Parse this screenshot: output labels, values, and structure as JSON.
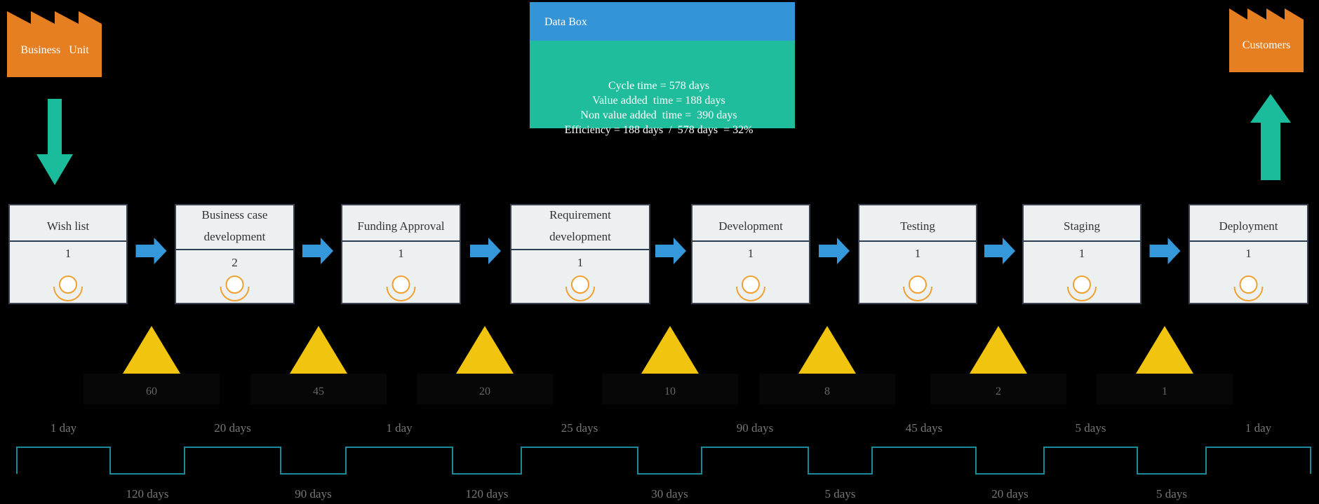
{
  "supplier": {
    "label": "Business   Unit",
    "icon": "factory-icon",
    "color": "#e67e22"
  },
  "customer": {
    "label": "Customers",
    "icon": "factory-icon",
    "color": "#e67e22"
  },
  "data_box": {
    "title": "Data Box",
    "lines": [
      "Cycle time = 578 days",
      "Value added  time = 188 days",
      "Non value added  time =  390 days",
      "Efficiency = 188 days  /  578 days  = 32%"
    ],
    "header_color": "#3498db",
    "body_color": "#1abc9c"
  },
  "processes": [
    {
      "name": [
        "Wish  list"
      ],
      "operators": "1"
    },
    {
      "name": [
        "Business    case",
        "development"
      ],
      "operators": "2"
    },
    {
      "name": [
        "Funding  Approval"
      ],
      "operators": "1"
    },
    {
      "name": [
        "Requirement",
        "development"
      ],
      "operators": "1"
    },
    {
      "name": [
        "Development"
      ],
      "operators": "1"
    },
    {
      "name": [
        "Testing"
      ],
      "operators": "1"
    },
    {
      "name": [
        "Staging"
      ],
      "operators": "1"
    },
    {
      "name": [
        "Deployment"
      ],
      "operators": "1"
    }
  ],
  "inventory": [
    "60",
    "45",
    "20",
    "10",
    "8",
    "2",
    "1"
  ],
  "timeline": {
    "value_added": [
      "1 day",
      "20 days",
      "1 day",
      "25 days",
      "90 days",
      "45 days",
      "5 days",
      "1 day"
    ],
    "waiting": [
      "120 days",
      "90 days",
      "120 days",
      "30 days",
      "5 days",
      "20 days",
      "5 days"
    ],
    "color": "#1a8a9a"
  },
  "colors": {
    "push_arrow": "#3498db",
    "flow_arrow": "#1abc9c",
    "inventory": "#f1c40f",
    "operator": "#f0a030"
  }
}
